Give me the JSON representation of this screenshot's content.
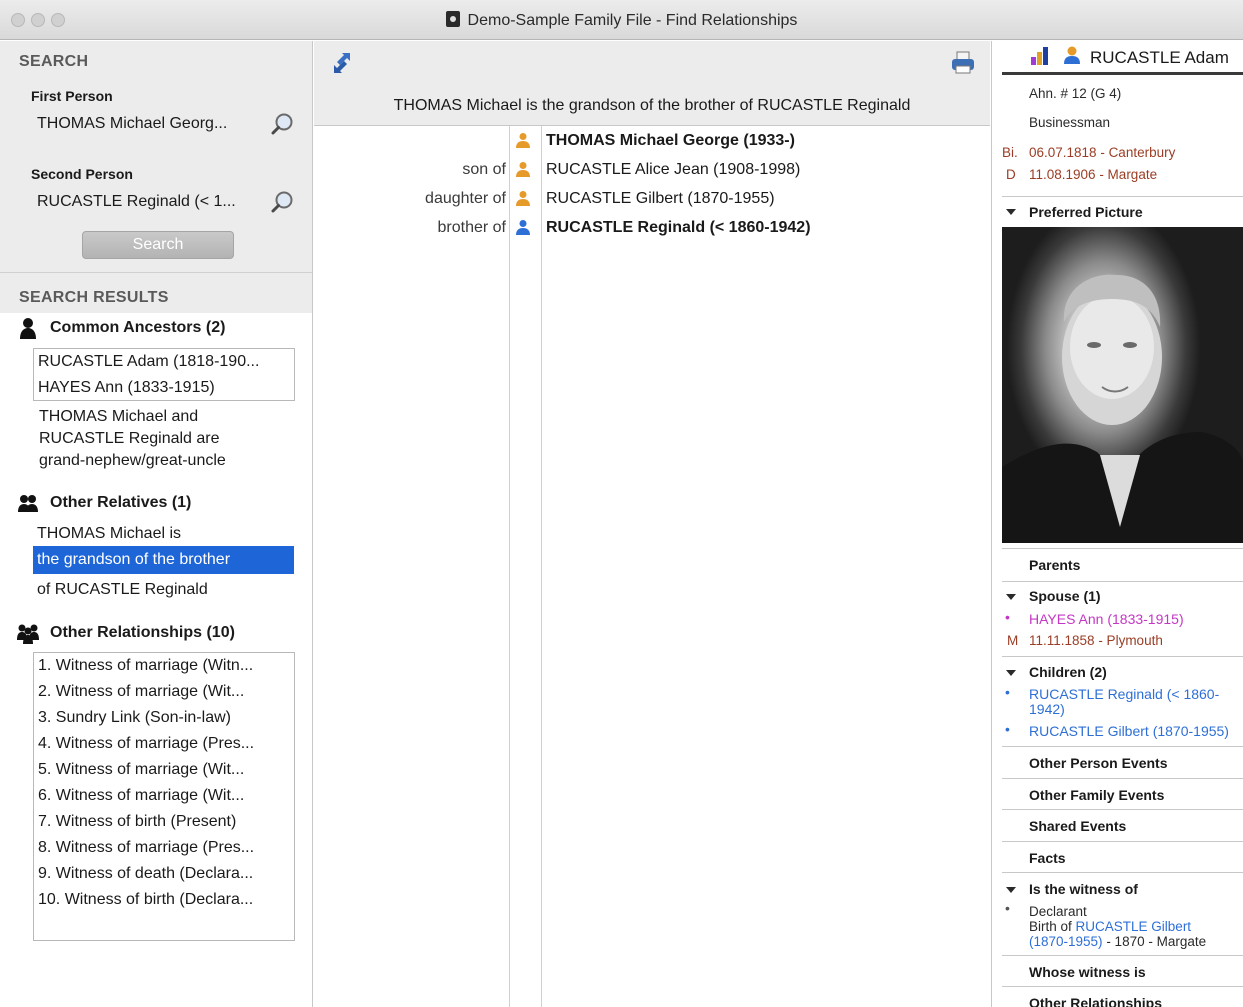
{
  "window": {
    "title": "Demo-Sample Family File - Find Relationships"
  },
  "search": {
    "heading": "SEARCH",
    "first_label": "First Person",
    "first_value": "THOMAS Michael Georg...",
    "second_label": "Second Person",
    "second_value": "RUCASTLE Reginald (< 1...",
    "button": "Search"
  },
  "results": {
    "heading": "SEARCH RESULTS",
    "common_ancestors": {
      "title": "Common Ancestors (2)",
      "items": [
        "RUCASTLE Adam (1818-190...",
        "HAYES Ann (1833-1915)"
      ],
      "summary": [
        "THOMAS Michael and",
        "RUCASTLE Reginald are",
        "grand-nephew/great-uncle"
      ]
    },
    "other_relatives": {
      "title": "Other Relatives (1)",
      "line1": "THOMAS Michael is",
      "selected": "the grandson of the brother",
      "line3": "of RUCASTLE Reginald"
    },
    "other_relationships": {
      "title": "Other Relationships (10)",
      "items": [
        "1. Witness of marriage (Witn...",
        "2. Witness of marriage (Wit...",
        "3. Sundry Link (Son-in-law)",
        "4. Witness of marriage (Pres...",
        "5. Witness of marriage (Wit...",
        "6. Witness of marriage (Wit...",
        "7. Witness of birth (Present)",
        "8. Witness of marriage (Pres...",
        "9. Witness of death (Declara...",
        "10. Witness of birth (Declara..."
      ]
    }
  },
  "middle": {
    "summary": "THOMAS Michael is the grandson of the brother of RUCASTLE Reginald",
    "chain": [
      {
        "label": "",
        "name": "THOMAS Michael George (1933-)",
        "bold": true,
        "color": "#e59a2a"
      },
      {
        "label": "son of",
        "name": "RUCASTLE Alice Jean (1908-1998)",
        "bold": false,
        "color": "#e59a2a"
      },
      {
        "label": "daughter of",
        "name": "RUCASTLE Gilbert (1870-1955)",
        "bold": false,
        "color": "#e59a2a"
      },
      {
        "label": "brother of",
        "name": "RUCASTLE Reginald (< 1860-1942)",
        "bold": true,
        "color": "#2e6fd6"
      }
    ]
  },
  "person": {
    "name": "RUCASTLE Adam",
    "ahn": "Ahn. # 12 (G 4)",
    "occupation": "Businessman",
    "birth_prefix": "Bi.",
    "birth": "06.07.1818 - Canterbury",
    "death_prefix": "D",
    "death": "11.08.1906 - Margate",
    "preferred_picture": "Preferred Picture",
    "parents": "Parents",
    "spouse_head": "Spouse (1)",
    "spouse_name": "HAYES Ann (1833-1915)",
    "marriage_prefix": "M",
    "marriage": "11.11.1858 - Plymouth",
    "children_head": "Children (2)",
    "child1": "RUCASTLE Reginald (< 1860-",
    "child1b": "1942)",
    "child2": "RUCASTLE Gilbert (1870-1955)",
    "other_person_events": "Other Person Events",
    "other_family_events": "Other Family Events",
    "shared_events": "Shared Events",
    "facts": "Facts",
    "witness_of_head": "Is the witness of",
    "witness_role": "Declarant",
    "witness_birth_of": "Birth of ",
    "witness_link1": "RUCASTLE Gilbert",
    "witness_link2": "(1870-1955)",
    "witness_tail": " - 1870 - Margate",
    "whose_witness": "Whose witness is",
    "other_relationships": "Other Relationships"
  },
  "colors": {
    "accent_blue": "#1e66d8",
    "link_blue": "#2e6fd6",
    "brown": "#9b3d24",
    "spouse_magenta": "#c437c4",
    "female_orange": "#e59a2a"
  }
}
